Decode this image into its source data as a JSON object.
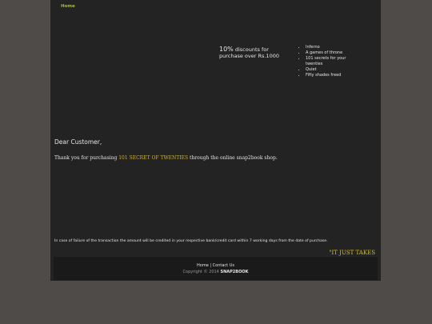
{
  "nav": {
    "home_label": "Home"
  },
  "promo": {
    "percent": "10%",
    "text_line1": "discounts for",
    "text_line2": "purchase over Rs.1000"
  },
  "books": [
    "Inferno",
    "A games of throne",
    "101 secrets for your twenties",
    "Quiet",
    "Fifty shades freed"
  ],
  "message": {
    "greeting": "Dear Customer,",
    "thanks_prefix": "Thank you for purchasing ",
    "product_name": "101 SECRET OF TWENTIES",
    "thanks_suffix": " through the online snap2book shop.",
    "failure_note": "In case of failure of the transaction the amount will be credited in your respective bank/credit card within 7 working days from the date of purchase.",
    "tagline": "\"IT JUST TAKES"
  },
  "footer": {
    "home_label": "Home",
    "separator": " | ",
    "contact_label": "Contact Us",
    "copyright_prefix": "Copyright © 2014 ",
    "brand": "SNAP2BOOK"
  },
  "colors": {
    "background": "#4f4b48",
    "panel": "#232323",
    "footer": "#1a1a1a",
    "accent_nav": "#a8b83a",
    "accent_product": "#c9b23a",
    "accent_tagline": "#d8c020"
  }
}
